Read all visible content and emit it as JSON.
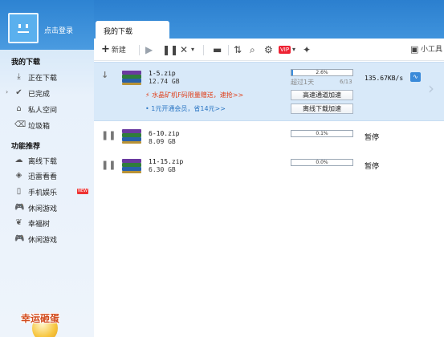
{
  "sidebar": {
    "login": "点击登录",
    "my_downloads_title": "我的下载",
    "downloading": "正在下载",
    "completed": "已完成",
    "private_space": "私人空间",
    "trash": "垃圾箱",
    "features_title": "功能推荐",
    "offline_download": "离线下载",
    "xunlei_watch": "迅雷看看",
    "mobile_fun": "手机娱乐",
    "new_badge": "NEW",
    "casual_games": "休闲游戏",
    "lucky_tree": "幸福树",
    "casual_games2": "休闲游戏",
    "lucky_egg": "幸运砸蛋"
  },
  "tab": {
    "label": "我的下载"
  },
  "toolbar": {
    "new_label": "新建",
    "vip": "VIP",
    "small_tools": "小工具"
  },
  "downloads": [
    {
      "name": "1-5.zip",
      "size": "12.74 GB",
      "progress_label": "2.6%",
      "progress": 0.026,
      "eta": "超过1天",
      "segments": "6/13",
      "speed": "135.67KB/s",
      "promo": "水晶矿机F码限量赠送，速抢>>",
      "promo2": "• 1元开通会员，省14元>>",
      "btn_high": "高速通道加速",
      "btn_offline": "离线下载加速"
    },
    {
      "name": "6-10.zip",
      "size": "8.09 GB",
      "progress_label": "0.1%",
      "progress": 0.001,
      "status": "暂停"
    },
    {
      "name": "11-15.zip",
      "size": "6.30 GB",
      "progress_label": "0.0%",
      "progress": 0.0,
      "status": "暂停"
    }
  ],
  "colors": {
    "accent": "#2b7fcf",
    "progress": "#3b8fe0",
    "promo": "#e0401a",
    "link": "#2b76c4"
  }
}
